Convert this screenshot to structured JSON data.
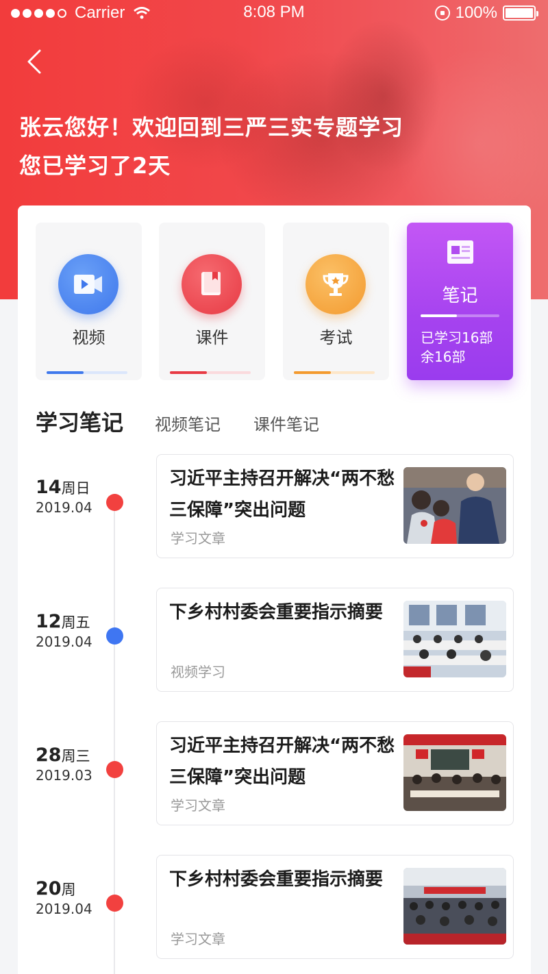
{
  "status_bar": {
    "carrier": "Carrier",
    "time": "8:08 PM",
    "battery": "100%"
  },
  "header": {
    "greeting_line1": "张云您好！欢迎回到三严三实专题学习",
    "greeting_line2": "您已学习了2天"
  },
  "categories": [
    {
      "label": "视频",
      "icon": "video-icon",
      "color": "#4a86f0",
      "progress": 0.46
    },
    {
      "label": "课件",
      "icon": "book-icon",
      "color": "#ef4a52",
      "progress": 0.46
    },
    {
      "label": "考试",
      "icon": "trophy-icon",
      "color": "#f6a63c",
      "progress": 0.46
    },
    {
      "label": "笔记",
      "icon": "notebook-icon",
      "progress": 0.46,
      "stat_line1": "已学习16部",
      "stat_line2": "余16部"
    }
  ],
  "section": {
    "title": "学习笔记",
    "tab1": "视频笔记",
    "tab2": "课件笔记"
  },
  "notes": [
    {
      "day": "14",
      "week": "周日",
      "ym": "2019.04",
      "dot_color": "#f2413f",
      "title": "习近平主持召开解决“两不愁三保障”突出问题",
      "tag": "学习文章"
    },
    {
      "day": "12",
      "week": "周五",
      "ym": "2019.04",
      "dot_color": "#3f76f2",
      "title": "下乡村村委会重要指示摘要",
      "tag": "视频学习"
    },
    {
      "day": "28",
      "week": "周三",
      "ym": "2019.03",
      "dot_color": "#f2413f",
      "title": "习近平主持召开解决“两不愁三保障”突出问题",
      "tag": "学习文章"
    },
    {
      "day": "20",
      "week": "周",
      "ym": "2019.04",
      "dot_color": "#f2413f",
      "title": "下乡村村委会重要指示摘要",
      "tag": "学习文章"
    }
  ]
}
